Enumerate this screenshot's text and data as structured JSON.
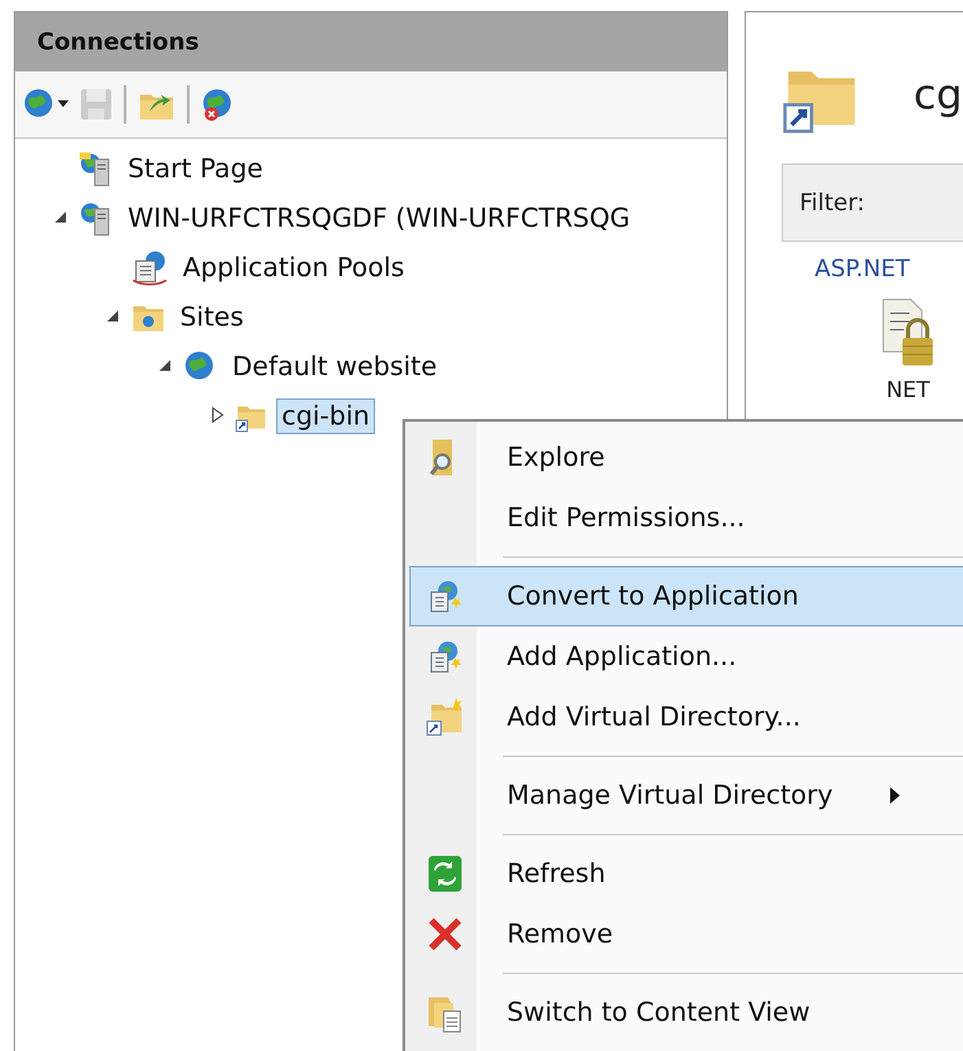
{
  "connections": {
    "title": "Connections",
    "toolbar": [
      {
        "kind": "connect"
      },
      {
        "kind": "save",
        "disabled": true
      },
      {
        "kind": "up"
      },
      {
        "kind": "disconnect"
      }
    ],
    "tree": [
      {
        "label": "Start Page",
        "kind": "start",
        "selected": false
      },
      {
        "label": "WIN-URFCTRSQGDF (WIN-URFCTRSQG",
        "kind": "server",
        "selected": false,
        "expanded": true,
        "children": [
          {
            "label": "Application Pools",
            "kind": "pools",
            "selected": false
          },
          {
            "label": "Sites",
            "kind": "sites",
            "selected": false,
            "expanded": true,
            "children": [
              {
                "label": "Default website",
                "kind": "site",
                "selected": false,
                "expanded": true,
                "children": [
                  {
                    "label": "cgi-bin",
                    "kind": "vdir",
                    "selected": true,
                    "expanded": false
                  }
                ]
              }
            ]
          }
        ]
      }
    ]
  },
  "content": {
    "title": "cg",
    "filter_label": "Filter:",
    "group": "ASP.NET",
    "feature": "NET"
  },
  "context_menu": [
    {
      "kind": "explore",
      "label": "Explore",
      "selected": false
    },
    {
      "kind": "plain",
      "label": "Edit Permissions...",
      "selected": false
    },
    {
      "kind": "separator"
    },
    {
      "kind": "app",
      "label": "Convert to Application",
      "selected": true
    },
    {
      "kind": "app",
      "label": "Add Application...",
      "selected": false
    },
    {
      "kind": "vdir",
      "label": "Add Virtual Directory...",
      "selected": false
    },
    {
      "kind": "separator"
    },
    {
      "kind": "submenu",
      "label": "Manage Virtual Directory",
      "selected": false
    },
    {
      "kind": "separator"
    },
    {
      "kind": "refresh",
      "label": "Refresh",
      "selected": false
    },
    {
      "kind": "remove",
      "label": "Remove",
      "selected": false
    },
    {
      "kind": "separator"
    },
    {
      "kind": "content",
      "label": "Switch to Content View",
      "selected": false
    }
  ]
}
